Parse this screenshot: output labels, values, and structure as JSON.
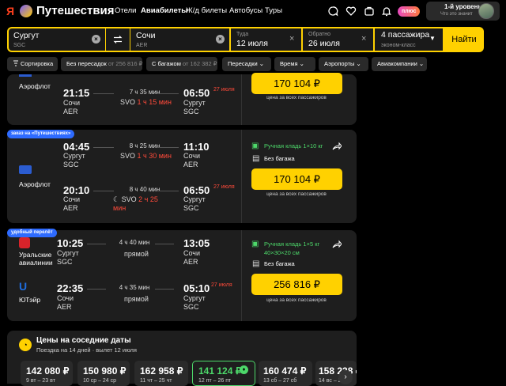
{
  "brand": {
    "name": "Путешествия"
  },
  "nav": {
    "hotels": "Отели",
    "avia": "Авиабилеты",
    "trains": "Ж/д билеты",
    "buses": "Автобусы",
    "tours": "Туры",
    "plus": "плюс"
  },
  "user": {
    "level": "1-й уровень",
    "level_link": "Что это значит"
  },
  "search": {
    "from_city": "Сургут",
    "from_code": "SGC",
    "to_city": "Сочи",
    "to_code": "AER",
    "there_label": "Туда",
    "there_date": "12 июля",
    "back_label": "Обратно",
    "back_date": "26 июля",
    "pax": "4 пассажира",
    "pax_class": "эконом-класс",
    "find": "Найти"
  },
  "filters": {
    "sort": "Сортировка",
    "nonstop": "Без пересадок",
    "nonstop_price": "от 256 816 ₽",
    "baggage": "С багажом",
    "baggage_price": "от 162 382 ₽",
    "transfers": "Пересадки",
    "time": "Время",
    "airports": "Аэропорты",
    "airlines": "Авиакомпании"
  },
  "card0": {
    "airline": "Аэрофлот",
    "dep_time": "21:15",
    "dep_city": "Сочи",
    "dep_code": "AER",
    "duration": "7 ч 35 мин",
    "via": "SVO",
    "via_layover": "1 ч 15 мин",
    "arr_time": "06:50",
    "arr_date": "27 июля",
    "arr_city": "Сургут",
    "arr_code": "SGC",
    "price": "170 104 ₽",
    "price_note": "цена за всех пассажиров"
  },
  "card1": {
    "badge": "заказ на «Путешествиях»",
    "airline": "Аэрофлот",
    "baggage_carry": "Ручная кладь 1×10 кг",
    "baggage_none": "Без багажа",
    "price": "170 104 ₽",
    "price_note": "цена за всех пассажиров",
    "out": {
      "dep_time": "04:45",
      "dep_city": "Сургут",
      "dep_code": "SGC",
      "duration": "8 ч 25 мин",
      "via": "SVO",
      "via_layover": "1 ч 30 мин",
      "arr_time": "11:10",
      "arr_city": "Сочи",
      "arr_code": "AER"
    },
    "ret": {
      "dep_time": "20:10",
      "dep_city": "Сочи",
      "dep_code": "AER",
      "duration": "8 ч 40 мин",
      "via": "SVO",
      "via_layover": "2 ч 25 мин",
      "arr_time": "06:50",
      "arr_date": "27 июля",
      "arr_city": "Сургут",
      "arr_code": "SGC"
    }
  },
  "card2": {
    "badge": "удобный перелёт",
    "airline_out": "Уральские авиалинии",
    "airline_ret": "ЮТэйр",
    "baggage_carry": "Ручная кладь 1×5 кг",
    "baggage_dims": "40×30×20 см",
    "baggage_none": "Без багажа",
    "price": "256 816 ₽",
    "price_note": "цена за всех пассажиров",
    "out": {
      "dep_time": "10:25",
      "dep_city": "Сургут",
      "dep_code": "SGC",
      "duration": "4 ч 40 мин",
      "direct": "прямой",
      "arr_time": "13:05",
      "arr_city": "Сочи",
      "arr_code": "AER"
    },
    "ret": {
      "dep_time": "22:35",
      "dep_city": "Сочи",
      "dep_code": "AER",
      "duration": "4 ч 35 мин",
      "direct": "прямой",
      "arr_time": "05:10",
      "arr_date": "27 июля",
      "arr_city": "Сургут",
      "arr_code": "SGC"
    }
  },
  "dates": {
    "title": "Цены на соседние даты",
    "subtitle": "Поездка на 14 дней · вылет 12 июля",
    "items": [
      {
        "price": "142 080 ₽",
        "range": "9 вт – 23 вт"
      },
      {
        "price": "150 980 ₽",
        "range": "10 ср – 24 ср"
      },
      {
        "price": "162 958 ₽",
        "range": "11 чт – 25 чт"
      },
      {
        "price": "141 124 ₽",
        "range": "12 пт – 26 пт"
      },
      {
        "price": "160 474 ₽",
        "range": "13 сб – 27 сб"
      },
      {
        "price": "158 238 ₽",
        "range": "14 вс – 28 вс"
      }
    ]
  },
  "colors": {
    "accent": "#ffd100",
    "badge": "#2e6bff",
    "alert": "#ff4a3a",
    "ok": "#4dd86a",
    "best": "#4dd86a"
  }
}
